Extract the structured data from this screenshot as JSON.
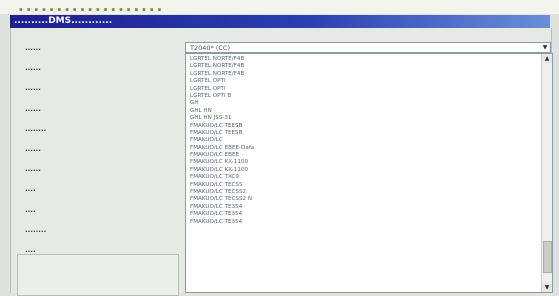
{
  "header_strip": "...................",
  "window": {
    "title": "..........DMS............"
  },
  "form": {
    "labels": [
      "......",
      "......",
      "......",
      "......",
      "........",
      "......",
      "......",
      "....",
      "....",
      "........",
      "....",
      "....",
      "...."
    ],
    "selected_value": "T2040* (CC)"
  },
  "dropdown": {
    "options": [
      "LGRTEL NORTE/F4B",
      "LGRTEL NORTE/F4B",
      "LGRTEL NORTE/F4B",
      "LGRTEL OPTI",
      "LGRTEL OPTI",
      "LGRTEL OPTI B",
      "GH",
      "GHL HN",
      "GHL HN JSS-31",
      "FMAKUO/LC TEESB",
      "FMAKUO/LC TEESB",
      "FMAKUO/LC",
      "FMAKUO/LC EBEE-Dafa",
      "FMAKUO/LC EBEE",
      "FMAKUO/LC KX-1100",
      "FMAKUO/LC KX-1100",
      "FMAKUO/LC TXC9",
      "FMAKUO/LC TECSS",
      "FMAKUO/LC TECSS2",
      "FMAKUO/LC TECSS2 N",
      "FMAKUO/LC TE354",
      "FMAKUO/LC TE354",
      "FMAKUO/LC TE354"
    ]
  },
  "icons": {
    "combo_arrow": "chevron-down-icon",
    "scroll_up": "chevron-up-icon",
    "scroll_down": "chevron-down-icon"
  }
}
